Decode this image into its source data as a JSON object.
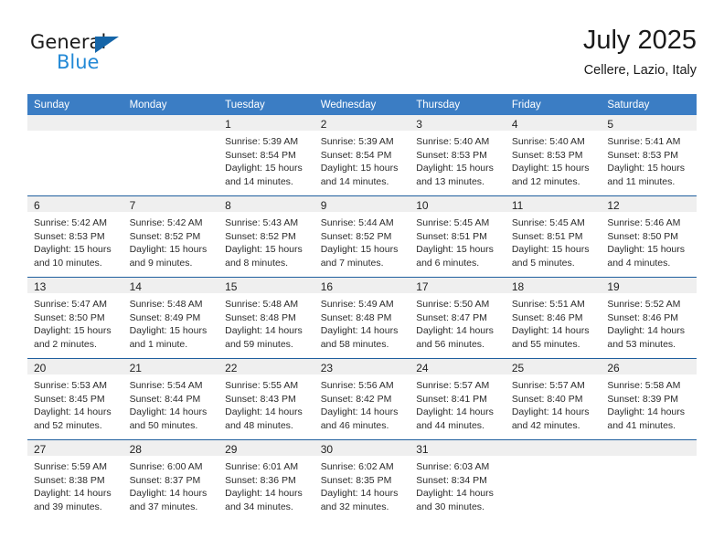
{
  "brand": {
    "name_top": "General",
    "name_bottom": "Blue",
    "triangle_color": "#1565a8",
    "blue_text_color": "#2389d6"
  },
  "header": {
    "title": "July 2025",
    "subtitle": "Cellere, Lazio, Italy"
  },
  "theme": {
    "header_bg": "#3b7dc4",
    "row_divider": "#1f5f9e",
    "daynum_band_bg": "#efefef"
  },
  "calendar": {
    "weekday_headers": [
      "Sunday",
      "Monday",
      "Tuesday",
      "Wednesday",
      "Thursday",
      "Friday",
      "Saturday"
    ],
    "weeks": [
      [
        {
          "day": "",
          "lines": []
        },
        {
          "day": "",
          "lines": []
        },
        {
          "day": "1",
          "lines": [
            "Sunrise: 5:39 AM",
            "Sunset: 8:54 PM",
            "Daylight: 15 hours",
            "and 14 minutes."
          ]
        },
        {
          "day": "2",
          "lines": [
            "Sunrise: 5:39 AM",
            "Sunset: 8:54 PM",
            "Daylight: 15 hours",
            "and 14 minutes."
          ]
        },
        {
          "day": "3",
          "lines": [
            "Sunrise: 5:40 AM",
            "Sunset: 8:53 PM",
            "Daylight: 15 hours",
            "and 13 minutes."
          ]
        },
        {
          "day": "4",
          "lines": [
            "Sunrise: 5:40 AM",
            "Sunset: 8:53 PM",
            "Daylight: 15 hours",
            "and 12 minutes."
          ]
        },
        {
          "day": "5",
          "lines": [
            "Sunrise: 5:41 AM",
            "Sunset: 8:53 PM",
            "Daylight: 15 hours",
            "and 11 minutes."
          ]
        }
      ],
      [
        {
          "day": "6",
          "lines": [
            "Sunrise: 5:42 AM",
            "Sunset: 8:53 PM",
            "Daylight: 15 hours",
            "and 10 minutes."
          ]
        },
        {
          "day": "7",
          "lines": [
            "Sunrise: 5:42 AM",
            "Sunset: 8:52 PM",
            "Daylight: 15 hours",
            "and 9 minutes."
          ]
        },
        {
          "day": "8",
          "lines": [
            "Sunrise: 5:43 AM",
            "Sunset: 8:52 PM",
            "Daylight: 15 hours",
            "and 8 minutes."
          ]
        },
        {
          "day": "9",
          "lines": [
            "Sunrise: 5:44 AM",
            "Sunset: 8:52 PM",
            "Daylight: 15 hours",
            "and 7 minutes."
          ]
        },
        {
          "day": "10",
          "lines": [
            "Sunrise: 5:45 AM",
            "Sunset: 8:51 PM",
            "Daylight: 15 hours",
            "and 6 minutes."
          ]
        },
        {
          "day": "11",
          "lines": [
            "Sunrise: 5:45 AM",
            "Sunset: 8:51 PM",
            "Daylight: 15 hours",
            "and 5 minutes."
          ]
        },
        {
          "day": "12",
          "lines": [
            "Sunrise: 5:46 AM",
            "Sunset: 8:50 PM",
            "Daylight: 15 hours",
            "and 4 minutes."
          ]
        }
      ],
      [
        {
          "day": "13",
          "lines": [
            "Sunrise: 5:47 AM",
            "Sunset: 8:50 PM",
            "Daylight: 15 hours",
            "and 2 minutes."
          ]
        },
        {
          "day": "14",
          "lines": [
            "Sunrise: 5:48 AM",
            "Sunset: 8:49 PM",
            "Daylight: 15 hours",
            "and 1 minute."
          ]
        },
        {
          "day": "15",
          "lines": [
            "Sunrise: 5:48 AM",
            "Sunset: 8:48 PM",
            "Daylight: 14 hours",
            "and 59 minutes."
          ]
        },
        {
          "day": "16",
          "lines": [
            "Sunrise: 5:49 AM",
            "Sunset: 8:48 PM",
            "Daylight: 14 hours",
            "and 58 minutes."
          ]
        },
        {
          "day": "17",
          "lines": [
            "Sunrise: 5:50 AM",
            "Sunset: 8:47 PM",
            "Daylight: 14 hours",
            "and 56 minutes."
          ]
        },
        {
          "day": "18",
          "lines": [
            "Sunrise: 5:51 AM",
            "Sunset: 8:46 PM",
            "Daylight: 14 hours",
            "and 55 minutes."
          ]
        },
        {
          "day": "19",
          "lines": [
            "Sunrise: 5:52 AM",
            "Sunset: 8:46 PM",
            "Daylight: 14 hours",
            "and 53 minutes."
          ]
        }
      ],
      [
        {
          "day": "20",
          "lines": [
            "Sunrise: 5:53 AM",
            "Sunset: 8:45 PM",
            "Daylight: 14 hours",
            "and 52 minutes."
          ]
        },
        {
          "day": "21",
          "lines": [
            "Sunrise: 5:54 AM",
            "Sunset: 8:44 PM",
            "Daylight: 14 hours",
            "and 50 minutes."
          ]
        },
        {
          "day": "22",
          "lines": [
            "Sunrise: 5:55 AM",
            "Sunset: 8:43 PM",
            "Daylight: 14 hours",
            "and 48 minutes."
          ]
        },
        {
          "day": "23",
          "lines": [
            "Sunrise: 5:56 AM",
            "Sunset: 8:42 PM",
            "Daylight: 14 hours",
            "and 46 minutes."
          ]
        },
        {
          "day": "24",
          "lines": [
            "Sunrise: 5:57 AM",
            "Sunset: 8:41 PM",
            "Daylight: 14 hours",
            "and 44 minutes."
          ]
        },
        {
          "day": "25",
          "lines": [
            "Sunrise: 5:57 AM",
            "Sunset: 8:40 PM",
            "Daylight: 14 hours",
            "and 42 minutes."
          ]
        },
        {
          "day": "26",
          "lines": [
            "Sunrise: 5:58 AM",
            "Sunset: 8:39 PM",
            "Daylight: 14 hours",
            "and 41 minutes."
          ]
        }
      ],
      [
        {
          "day": "27",
          "lines": [
            "Sunrise: 5:59 AM",
            "Sunset: 8:38 PM",
            "Daylight: 14 hours",
            "and 39 minutes."
          ]
        },
        {
          "day": "28",
          "lines": [
            "Sunrise: 6:00 AM",
            "Sunset: 8:37 PM",
            "Daylight: 14 hours",
            "and 37 minutes."
          ]
        },
        {
          "day": "29",
          "lines": [
            "Sunrise: 6:01 AM",
            "Sunset: 8:36 PM",
            "Daylight: 14 hours",
            "and 34 minutes."
          ]
        },
        {
          "day": "30",
          "lines": [
            "Sunrise: 6:02 AM",
            "Sunset: 8:35 PM",
            "Daylight: 14 hours",
            "and 32 minutes."
          ]
        },
        {
          "day": "31",
          "lines": [
            "Sunrise: 6:03 AM",
            "Sunset: 8:34 PM",
            "Daylight: 14 hours",
            "and 30 minutes."
          ]
        },
        {
          "day": "",
          "lines": []
        },
        {
          "day": "",
          "lines": []
        }
      ]
    ]
  }
}
